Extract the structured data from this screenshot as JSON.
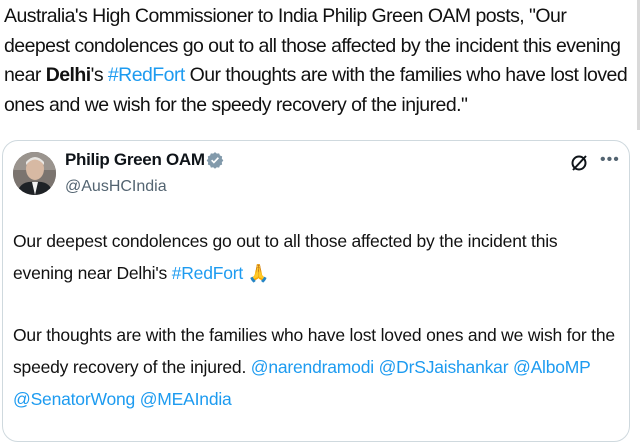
{
  "caption": {
    "part1": "Australia's High Commissioner to India Philip Green OAM posts, \"Our deepest condolences go out to all those affected by the incident this evening near ",
    "bold": "Delhi",
    "part2": "'s ",
    "hashtag": "#RedFort",
    "part3": " Our thoughts are with the families who have lost loved ones and we wish for the speedy recovery of the injured.\""
  },
  "tweet": {
    "author_name": "Philip Green OAM",
    "author_handle": "@AusHCIndia",
    "verified_icon": "verified-badge-icon",
    "grok_icon": "grok-icon",
    "more_icon": "more-dots-icon",
    "para1_text": "Our deepest condolences go out to all those affected by the incident this evening near Delhi's ",
    "para1_hashtag": "#RedFort",
    "para1_emoji": "🙏",
    "para2_text": "Our thoughts are with the families who have lost loved ones and we wish for the speedy recovery of the injured. ",
    "mentions": [
      "@narendramodi",
      "@DrSJaishankar",
      "@AlboMP",
      "@SenatorWong",
      "@MEAIndia"
    ]
  },
  "colors": {
    "link": "#1d9bf0",
    "text": "#0f1419",
    "muted": "#536471",
    "border": "#cfd9de"
  }
}
